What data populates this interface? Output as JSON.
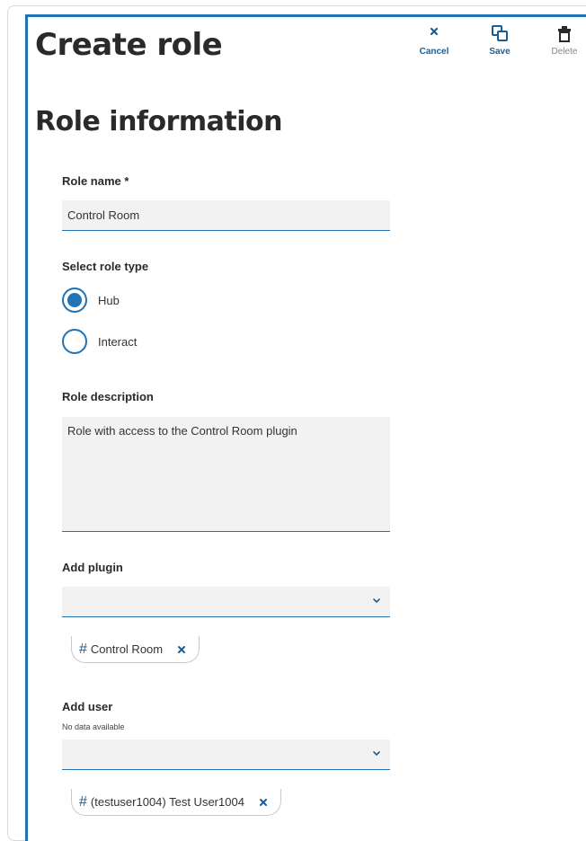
{
  "header": {
    "title": "Create role"
  },
  "toolbar": {
    "cancel_label": "Cancel",
    "save_label": "Save",
    "delete_label": "Delete"
  },
  "section": {
    "title": "Role information"
  },
  "role_name": {
    "label": "Role name *",
    "value": "Control Room"
  },
  "role_type": {
    "label": "Select role type",
    "options": [
      {
        "label": "Hub",
        "checked": true
      },
      {
        "label": "Interact",
        "checked": false
      }
    ]
  },
  "role_description": {
    "label": "Role description",
    "value": "Role with access to the Control Room plugin"
  },
  "add_plugin": {
    "label": "Add plugin",
    "chips": [
      {
        "text": "Control Room"
      }
    ]
  },
  "add_user": {
    "label": "Add user",
    "note": "No data available",
    "chips": [
      {
        "text": "(testuser1004) Test User1004"
      }
    ]
  },
  "colors": {
    "accent": "#1f73b7",
    "label_blue": "#1b5e97",
    "field_bg": "#f2f2f2"
  },
  "icons": {
    "cancel": "close-icon",
    "save": "copy-icon",
    "delete": "trash-icon",
    "dropdown": "chevron-down-icon",
    "chip_prefix": "hash-icon",
    "chip_remove": "close-icon"
  }
}
